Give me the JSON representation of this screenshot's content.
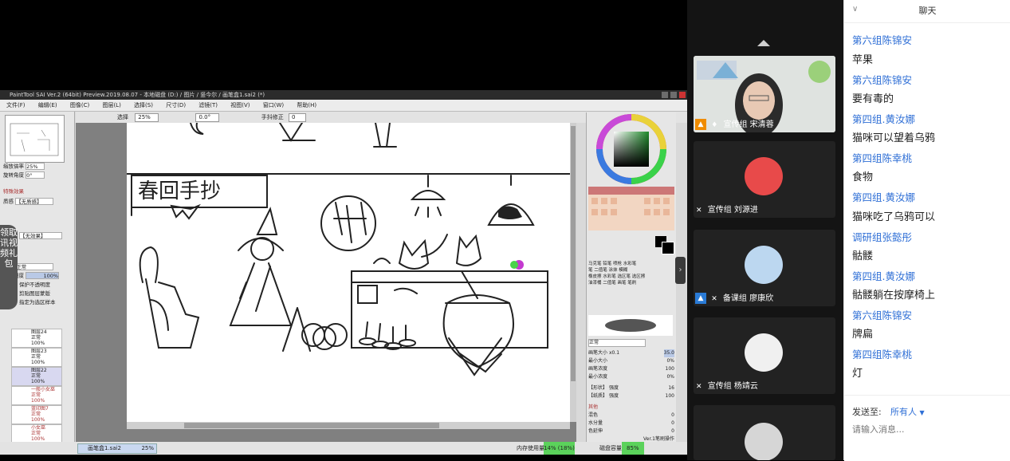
{
  "sai": {
    "title": "PaintTool SAI Ver.2 (64bit) Preview.2019.08.07 - 本地磁盘 (D:) / 图片 / 竖今尔 / 画笔盒1.sai2 (*)",
    "menu": [
      "文件(F)",
      "编辑(E)",
      "图像(C)",
      "图层(L)",
      "选择(S)",
      "尺寸(D)",
      "滤镜(T)",
      "视图(V)",
      "窗口(W)",
      "帮助(H)"
    ],
    "toolbar": {
      "selection_label": "选择",
      "zoom": "25%",
      "angle": "0.0°",
      "stabilizer_label": "手抖修正",
      "stabilizer_value": "0"
    },
    "left_panel": {
      "zoom_label": "缩放倍率",
      "zoom_value": "25%",
      "rotate_label": "旋转角度",
      "rotate_value": "0°",
      "section_label": "特殊效果",
      "texture_label": "质感",
      "texture_value": "【无质感】",
      "effect_value": "【无效果】",
      "blend_label": "混合",
      "blend_value": "正常",
      "opacity_label": "不透明度",
      "opacity_value": "100%",
      "lock_label": "保护不透明度",
      "clip_label": "剪贴图层蒙版",
      "select_label": "指定为选区样本",
      "layers": [
        {
          "name": "图层24",
          "mode": "正常",
          "opacity": "100%"
        },
        {
          "name": "图层23",
          "mode": "正常",
          "opacity": "100%"
        },
        {
          "name": "图层22",
          "mode": "正常",
          "opacity": "100%"
        },
        {
          "name": "一般小女巫",
          "mode": "正常",
          "opacity": "100%"
        },
        {
          "name": "蓝印图7",
          "mode": "正常",
          "opacity": "100%"
        },
        {
          "name": "小女巫",
          "mode": "正常",
          "opacity": "100%"
        }
      ]
    },
    "canvas": {
      "sign_text": "春回手抄"
    },
    "right_panel": {
      "tools": [
        "马克笔",
        "铅笔",
        "喷枪",
        "水彩笔",
        "笔",
        "二值笔",
        "涂抹",
        "模糊",
        "橡皮擦",
        "水彩笔",
        "选区笔",
        "选区擦",
        "油漆桶",
        "二值笔",
        "画笔",
        "笔刷"
      ],
      "blend_mode": "正常",
      "brush_size_label": "画笔大小",
      "brush_size_mult": "x0.1",
      "brush_size_value": "35.0",
      "min_size_label": "最小大小",
      "min_size_value": "0%",
      "density_label": "画笔浓度",
      "density_value": "100",
      "min_density_label": "最小浓度",
      "min_density_value": "0%",
      "edge_label": "【形状】",
      "edge_value": "强度",
      "edge_num": "16",
      "texture_label": "【纸质】",
      "texture_value": "强度",
      "texture_num": "100",
      "other_label": "其他",
      "other_rows": [
        {
          "label": "混色",
          "value": "0"
        },
        {
          "label": "水分量",
          "value": "0"
        },
        {
          "label": "色延伸",
          "value": "0"
        }
      ],
      "keep_label": "Ver.1笔刷操作"
    },
    "status": {
      "file_tab": "画笔盒1.sai2",
      "file_zoom": "25%",
      "mem_label": "内存使用量",
      "mem_value": "14% (18%)",
      "drive_label": "磁盘容量",
      "drive_value": "85%"
    }
  },
  "side_banner": "领取讯视频礼包",
  "video": {
    "tiles": [
      {
        "group": "宣传组",
        "name": "宋清蓉",
        "badge": "person"
      },
      {
        "group": "宣传组",
        "name": "刘源进",
        "badge": "none"
      },
      {
        "group": "备课组",
        "name": "廖康欣",
        "badge": "person"
      },
      {
        "group": "宣传组",
        "name": "杨靖云",
        "badge": "none"
      }
    ],
    "colors": {
      "tile_bg": "#222222",
      "badge_orange": "#f08c00",
      "badge_blue": "#2a7bd6"
    }
  },
  "chat": {
    "title": "聊天",
    "messages": [
      {
        "sender": "第六组陈锦安",
        "text": "苹果"
      },
      {
        "sender": "第六组陈锦安",
        "text": "要有毒的"
      },
      {
        "sender": "第四组.黄汝娜",
        "text": "猫咪可以望着乌鸦"
      },
      {
        "sender": "第四组陈幸桃",
        "text": "食物"
      },
      {
        "sender": "第四组.黄汝娜",
        "text": "猫咪吃了乌鸦可以"
      },
      {
        "sender": "调研组张懿彤",
        "text": "骷髅"
      },
      {
        "sender": "第四组.黄汝娜",
        "text": "骷髅躺在按摩椅上"
      },
      {
        "sender": "第六组陈锦安",
        "text": "牌扁"
      },
      {
        "sender": "第四组陈幸桃",
        "text": "灯"
      }
    ],
    "send_to_label": "发送至:",
    "send_to_value": "所有人",
    "input_placeholder": "请输入消息...",
    "colors": {
      "name": "#2f6fd6",
      "text": "#222222"
    }
  }
}
